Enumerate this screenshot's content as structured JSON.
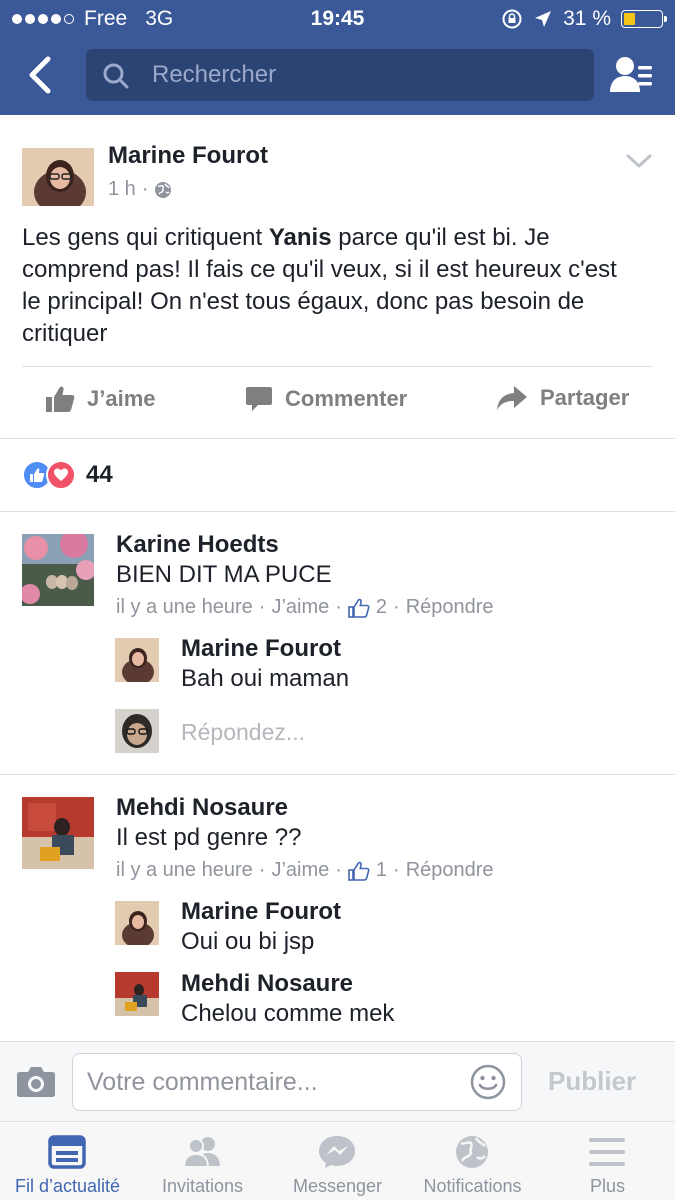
{
  "status_bar": {
    "carrier": "Free",
    "network": "3G",
    "time": "19:45",
    "battery": "31 %",
    "battery_level": 0.31
  },
  "search": {
    "placeholder": "Rechercher"
  },
  "post": {
    "author": "Marine Fourot",
    "time": "1 h",
    "audience_icon": "globe-icon",
    "text_before": "Les gens qui critiquent ",
    "text_bold": "Yanis",
    "text_after": " parce qu'il est bi. Je comprend pas! Il fais ce qu'il veux, si il est heureux c'est le principal! On n'est tous égaux, donc pas besoin de critiquer",
    "actions": {
      "like": "J’aime",
      "comment": "Commenter",
      "share": "Partager"
    },
    "reaction_count": "44"
  },
  "comments": [
    {
      "author": "Karine Hoedts",
      "text": "BIEN DIT MA PUCE",
      "time": "il y a une heure",
      "like_label": "J’aime",
      "likes": "2",
      "reply_label": "Répondre",
      "replies": [
        {
          "author": "Marine Fourot",
          "text": "Bah oui maman"
        }
      ],
      "reply_placeholder": "Répondez..."
    },
    {
      "author": "Mehdi Nosaure",
      "text": "Il est pd genre ??",
      "time": "il y a une heure",
      "like_label": "J’aime",
      "likes": "1",
      "reply_label": "Répondre",
      "replies": [
        {
          "author": "Marine Fourot",
          "text": "Oui ou bi jsp"
        },
        {
          "author": "Mehdi Nosaure",
          "text": "Chelou comme mek"
        }
      ]
    }
  ],
  "composer": {
    "placeholder": "Votre commentaire...",
    "publish": "Publier"
  },
  "tabs": [
    {
      "label": "Fil d’actualité",
      "icon": "news-feed-icon",
      "active": true
    },
    {
      "label": "Invitations",
      "icon": "friend-requests-icon"
    },
    {
      "label": "Messenger",
      "icon": "messenger-icon"
    },
    {
      "label": "Notifications",
      "icon": "globe-icon"
    },
    {
      "label": "Plus",
      "icon": "menu-icon"
    }
  ],
  "colors": {
    "header": "#3b5998",
    "search_field": "#2c4474",
    "active_tab": "#4267b2",
    "like_reaction": "#4f8df5",
    "love_reaction": "#f25268",
    "battery": "#f5c518"
  }
}
